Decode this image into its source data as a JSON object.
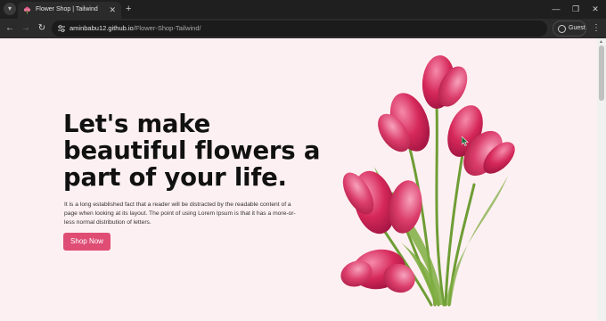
{
  "browser": {
    "tab": {
      "title": "Flower Shop | Tailwind",
      "close": "✕"
    },
    "new_tab": "+",
    "window_controls": {
      "minimize": "—",
      "restore": "❐",
      "close": "✕"
    },
    "nav": {
      "back": "←",
      "forward": "→",
      "reload": "↻"
    },
    "url_host": "aminbabu12.github.io",
    "url_path": "/Flower-Shop-Tailwind/",
    "profile": "Guest",
    "menu": "⋮"
  },
  "page": {
    "heading": "Let's make beautiful flowers a part of your life.",
    "body": "It is a long established fact that a reader will be distracted by the readable content of a page when looking at its layout. The point of using Lorem Ipsum is that it has a more-or-less normal distribution of letters.",
    "cta": "Shop Now"
  },
  "colors": {
    "accent": "#df4d75",
    "page_bg": "#fdf0f2",
    "heading": "#111111",
    "petal": "#d6285a",
    "stem": "#7ba93c"
  },
  "icons": {
    "tab_search": "chevron-down-icon",
    "favicon": "flower-icon",
    "site_info": "tune-icon",
    "profile": "person-icon",
    "scroll": "arrow-up-icon"
  }
}
